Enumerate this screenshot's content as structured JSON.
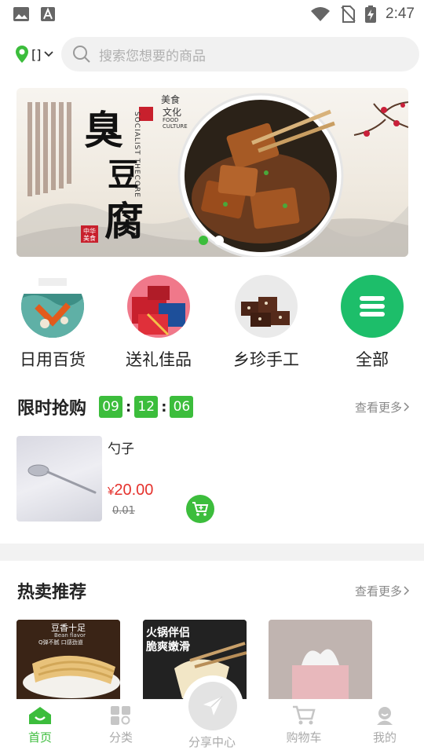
{
  "status_bar": {
    "time": "2:47"
  },
  "header": {
    "location": "[]",
    "search_placeholder": "搜索您想要的商品"
  },
  "banner": {
    "title_chars": [
      "臭",
      "豆",
      "腐"
    ],
    "tag_lines": [
      "美食",
      "文化"
    ],
    "tag_en": [
      "FOOD",
      "CULTURE"
    ],
    "vertical_en": "SOCIALIST THECORE",
    "seal": "中华美食",
    "slides": 2,
    "active_slide": 1
  },
  "categories": [
    {
      "label": "日用百货"
    },
    {
      "label": "送礼佳品"
    },
    {
      "label": "乡珍手工"
    },
    {
      "label": "全部"
    }
  ],
  "flash_sale": {
    "title": "限时抢购",
    "countdown": {
      "h": "09",
      "m": "12",
      "s": "06"
    },
    "more": "查看更多",
    "item": {
      "name": "勺子",
      "currency": "¥",
      "price": "20.00",
      "old_price": "0.01"
    }
  },
  "hot": {
    "title": "热卖推荐",
    "more": "查看更多",
    "cards": [
      {
        "caption": "豆香十足",
        "sub": "Bean flavor",
        "note": "Q弹不腻  口感劲道"
      },
      {
        "caption": "火锅伴侣",
        "sub2": "脆爽嫩滑"
      },
      {
        "caption": ""
      }
    ]
  },
  "tabbar": [
    {
      "label": "首页",
      "active": true
    },
    {
      "label": "分类"
    },
    {
      "label": "分享中心"
    },
    {
      "label": "购物车"
    },
    {
      "label": "我的"
    }
  ],
  "colors": {
    "accent": "#3cbd3c",
    "price": "#e5322d"
  }
}
